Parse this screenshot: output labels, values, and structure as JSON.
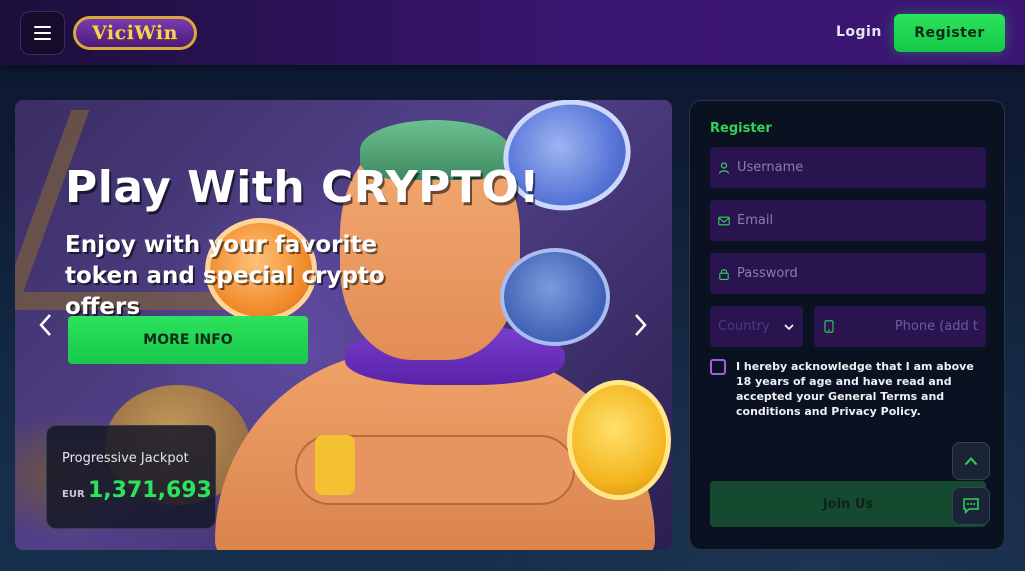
{
  "header": {
    "logo_text": "ViciWin",
    "login_label": "Login",
    "register_label": "Register",
    "menu_icon": "hamburger-icon"
  },
  "banner": {
    "title": "Play With CRYPTO!",
    "subtitle": "Enjoy with your favorite token and special crypto offers",
    "cta_label": "MORE INFO",
    "prev_icon": "chevron-left-icon",
    "next_icon": "chevron-right-icon",
    "jackpot": {
      "label": "Progressive Jackpot",
      "currency": "EUR",
      "amount": "1,371,693"
    }
  },
  "register_form": {
    "title": "Register",
    "username_placeholder": "Username",
    "email_placeholder": "Email",
    "password_placeholder": "Password",
    "country_placeholder": "Country",
    "phone_placeholder": "Phone (add t",
    "terms_text": "I hereby acknowledge that I am above 18 years of age and have read and accepted your General Terms and conditions and Privacy Policy.",
    "submit_label": "Join Us"
  },
  "colors": {
    "accent_green": "#2de25c",
    "header_purple": "#3a1570",
    "field_bg": "#2a1450",
    "panel_bg": "#0a1120"
  }
}
